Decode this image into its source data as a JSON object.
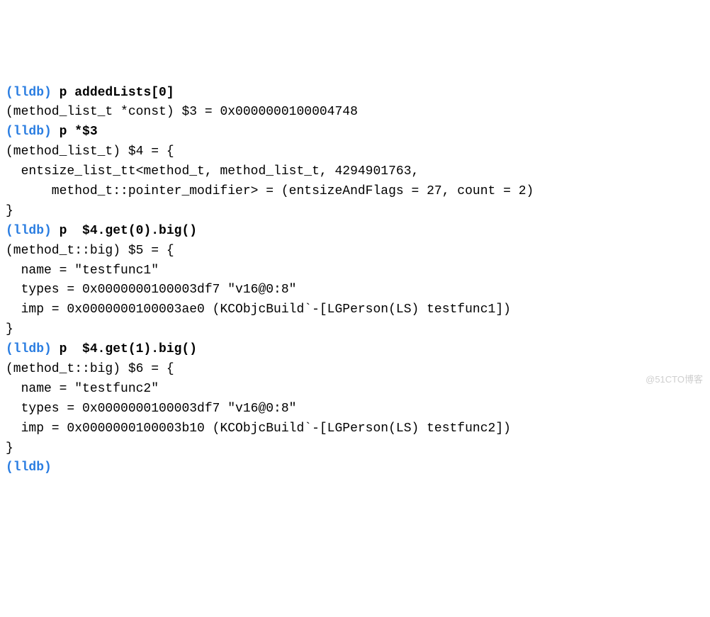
{
  "prompt": "(lldb)",
  "commands": [
    {
      "input": "p addedLists[0]",
      "output": [
        "(method_list_t *const) $3 = 0x0000000100004748"
      ]
    },
    {
      "input": "p *$3",
      "output": [
        "(method_list_t) $4 = {",
        "  entsize_list_tt<method_t, method_list_t, 4294901763,",
        "      method_t::pointer_modifier> = (entsizeAndFlags = 27, count = 2)",
        "}"
      ]
    },
    {
      "input": "p  $4.get(0).big()",
      "output": [
        "(method_t::big) $5 = {",
        "  name = \"testfunc1\"",
        "  types = 0x0000000100003df7 \"v16@0:8\"",
        "  imp = 0x0000000100003ae0 (KCObjcBuild`-[LGPerson(LS) testfunc1])",
        "}"
      ]
    },
    {
      "input": "p  $4.get(1).big()",
      "output": [
        "(method_t::big) $6 = {",
        "  name = \"testfunc2\"",
        "  types = 0x0000000100003df7 \"v16@0:8\"",
        "  imp = 0x0000000100003b10 (KCObjcBuild`-[LGPerson(LS) testfunc2])",
        "}"
      ]
    }
  ],
  "trailing_prompt": "(lldb)",
  "watermark": "@51CTO博客"
}
